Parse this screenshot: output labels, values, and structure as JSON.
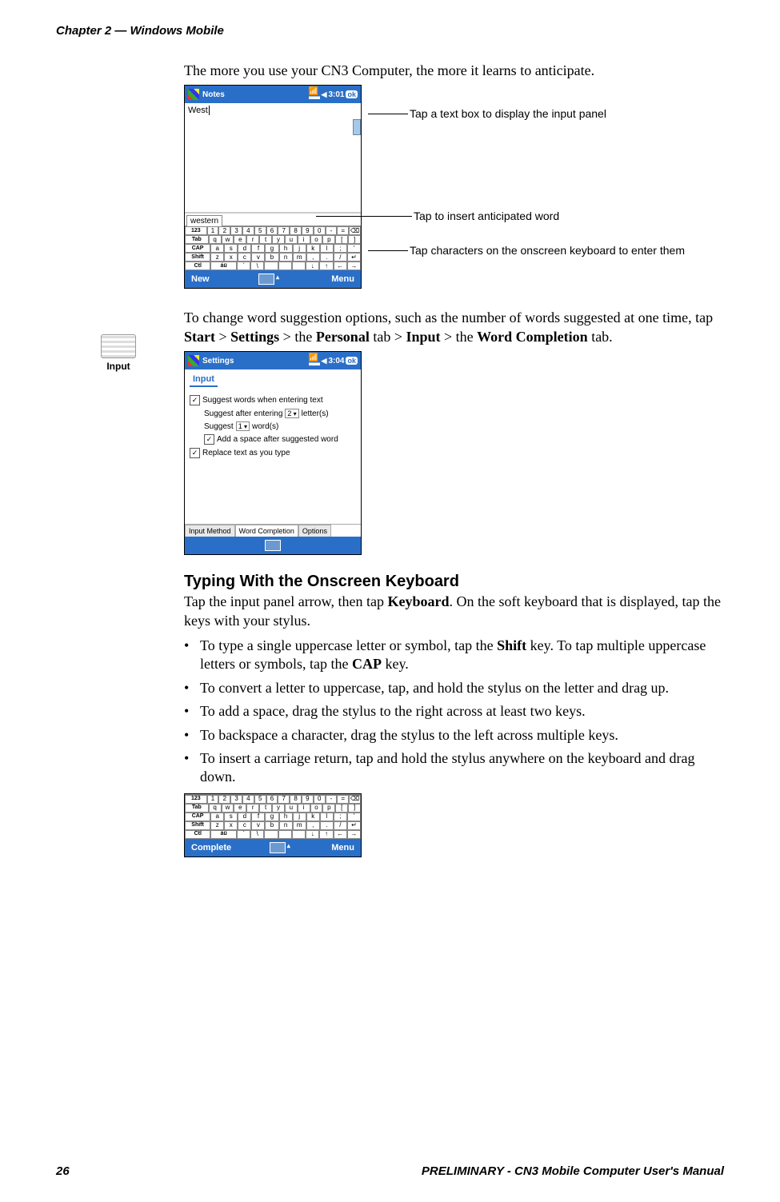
{
  "header": "Chapter 2 — Windows Mobile",
  "intro_para": "The more you use your CN3 Computer, the more it learns to anticipate.",
  "notes_screenshot": {
    "title": "Notes",
    "clock": "3:01",
    "ok": "ok",
    "typed": "West",
    "suggestion": "western",
    "bottom_left": "New",
    "bottom_right": "Menu"
  },
  "osk_rows": {
    "r1": [
      "123",
      "1",
      "2",
      "3",
      "4",
      "5",
      "6",
      "7",
      "8",
      "9",
      "0",
      "-",
      "=",
      "⌫"
    ],
    "r2": [
      "Tab",
      "q",
      "w",
      "e",
      "r",
      "t",
      "y",
      "u",
      "i",
      "o",
      "p",
      "[",
      "]"
    ],
    "r3": [
      "CAP",
      "a",
      "s",
      "d",
      "f",
      "g",
      "h",
      "j",
      "k",
      "l",
      ";",
      "'"
    ],
    "r4": [
      "Shift",
      "z",
      "x",
      "c",
      "v",
      "b",
      "n",
      "m",
      ",",
      ".",
      "/",
      "↵"
    ],
    "r5": [
      "Ctl",
      "áü",
      "`",
      "\\",
      " ",
      " ",
      " ",
      "↓",
      "↑",
      "←",
      "→"
    ]
  },
  "callouts": {
    "text_box": "Tap a text box to display the input panel",
    "suggest": "Tap to insert anticipated word",
    "keys": "Tap characters on the onscreen keyboard to enter them"
  },
  "input_icon_label": "Input",
  "change_para_pre": "To change word suggestion options, such as the number of words suggested at one time, tap ",
  "change_bold": [
    "Start",
    "Settings",
    "Personal",
    "Input",
    "Word Completion"
  ],
  "change_para_segments": [
    " > ",
    " > the ",
    " tab > ",
    " > the ",
    " tab."
  ],
  "settings_screenshot": {
    "title": "Settings",
    "clock": "3:04",
    "ok": "ok",
    "section": "Input",
    "chk_suggest": "Suggest words when entering text",
    "row_after": "Suggest after entering",
    "row_after_val": "2",
    "row_after_unit": "letter(s)",
    "row_suggest": "Suggest",
    "row_suggest_val": "1",
    "row_suggest_unit": "word(s)",
    "chk_space": "Add a space after suggested word",
    "chk_replace": "Replace text as you type",
    "tabs": [
      "Input Method",
      "Word Completion",
      "Options"
    ]
  },
  "section_heading": "Typing With the Onscreen Keyboard",
  "section_para_pre": "Tap the input panel arrow, then tap ",
  "section_para_bold": "Keyboard",
  "section_para_post": ". On the soft keyboard that is displayed, tap the keys with your stylus.",
  "bullets": [
    {
      "pre": "To type a single uppercase letter or symbol, tap the ",
      "b1": "Shift",
      "mid": " key. To tap multiple uppercase letters or symbols, tap the ",
      "b2": "CAP",
      "post": " key."
    },
    {
      "text": "To convert a letter to uppercase, tap, and hold the stylus on the letter and drag up."
    },
    {
      "text": "To add a space, drag the stylus to the right across at least two keys."
    },
    {
      "text": "To backspace a character, drag the stylus to the left across multiple keys."
    },
    {
      "text": "To insert a carriage return, tap and hold the stylus anywhere on the keyboard and drag down."
    }
  ],
  "small_bottom": {
    "left": "Complete",
    "right": "Menu"
  },
  "footer": {
    "page": "26",
    "title": "PRELIMINARY - CN3 Mobile Computer User's Manual"
  }
}
